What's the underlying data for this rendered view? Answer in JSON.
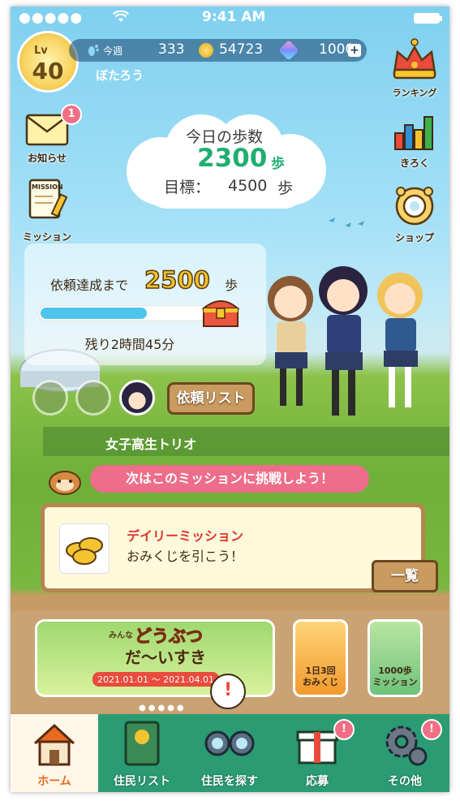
{
  "status_bar": {
    "signal": "●●●●●",
    "time": "9:41 AM"
  },
  "player": {
    "level_label": "Lv",
    "level": "40",
    "name": "ぼたろう",
    "weekly_label": "今週",
    "weekly_steps": "333",
    "coins": "54723",
    "gems": "1000"
  },
  "side_left": {
    "news": "お知らせ",
    "news_badge": "1",
    "mission": "ミッション",
    "mission_card": "MISSION"
  },
  "side_right": {
    "ranking": "ランキング",
    "records": "きろく",
    "shop": "ショップ"
  },
  "today": {
    "title": "今日の歩数",
    "steps": "2300",
    "unit": "歩",
    "goal_label": "目標：",
    "goal": "4500",
    "goal_unit": "歩"
  },
  "request": {
    "until_label": "依頼達成まで",
    "steps_left": "2500",
    "unit": "歩",
    "progress": 0.65,
    "remaining": "残り2時間45分",
    "list_button": "依頼リスト",
    "team_name": "女子高生トリオ"
  },
  "next": {
    "prompt": "次はこのミッションに挑戦しよう！",
    "mission_title": "デイリーミッション",
    "mission_text": "おみくじを引こう！",
    "all_button": "一覧"
  },
  "banners": {
    "main_small": "みんな",
    "main_title1": "どうぶつ",
    "main_title2": "だ～いすき",
    "main_dates": "2021.01.01 ～ 2021.04.01",
    "omikuji": [
      "1日3回",
      "おみくじ"
    ],
    "steps_mission": [
      "1000歩",
      "ミッション"
    ],
    "pager": "●●●●●"
  },
  "tabs": {
    "home": "ホーム",
    "residents": "住民リスト",
    "search": "住民を探す",
    "apply": "応募",
    "others": "その他",
    "apply_badge": "!",
    "others_badge": "!"
  },
  "colors": {
    "tab_green": "#2a9b73",
    "accent_green": "#1fae6f",
    "pink": "#ee6d8a",
    "gold": "#f2c22c"
  }
}
